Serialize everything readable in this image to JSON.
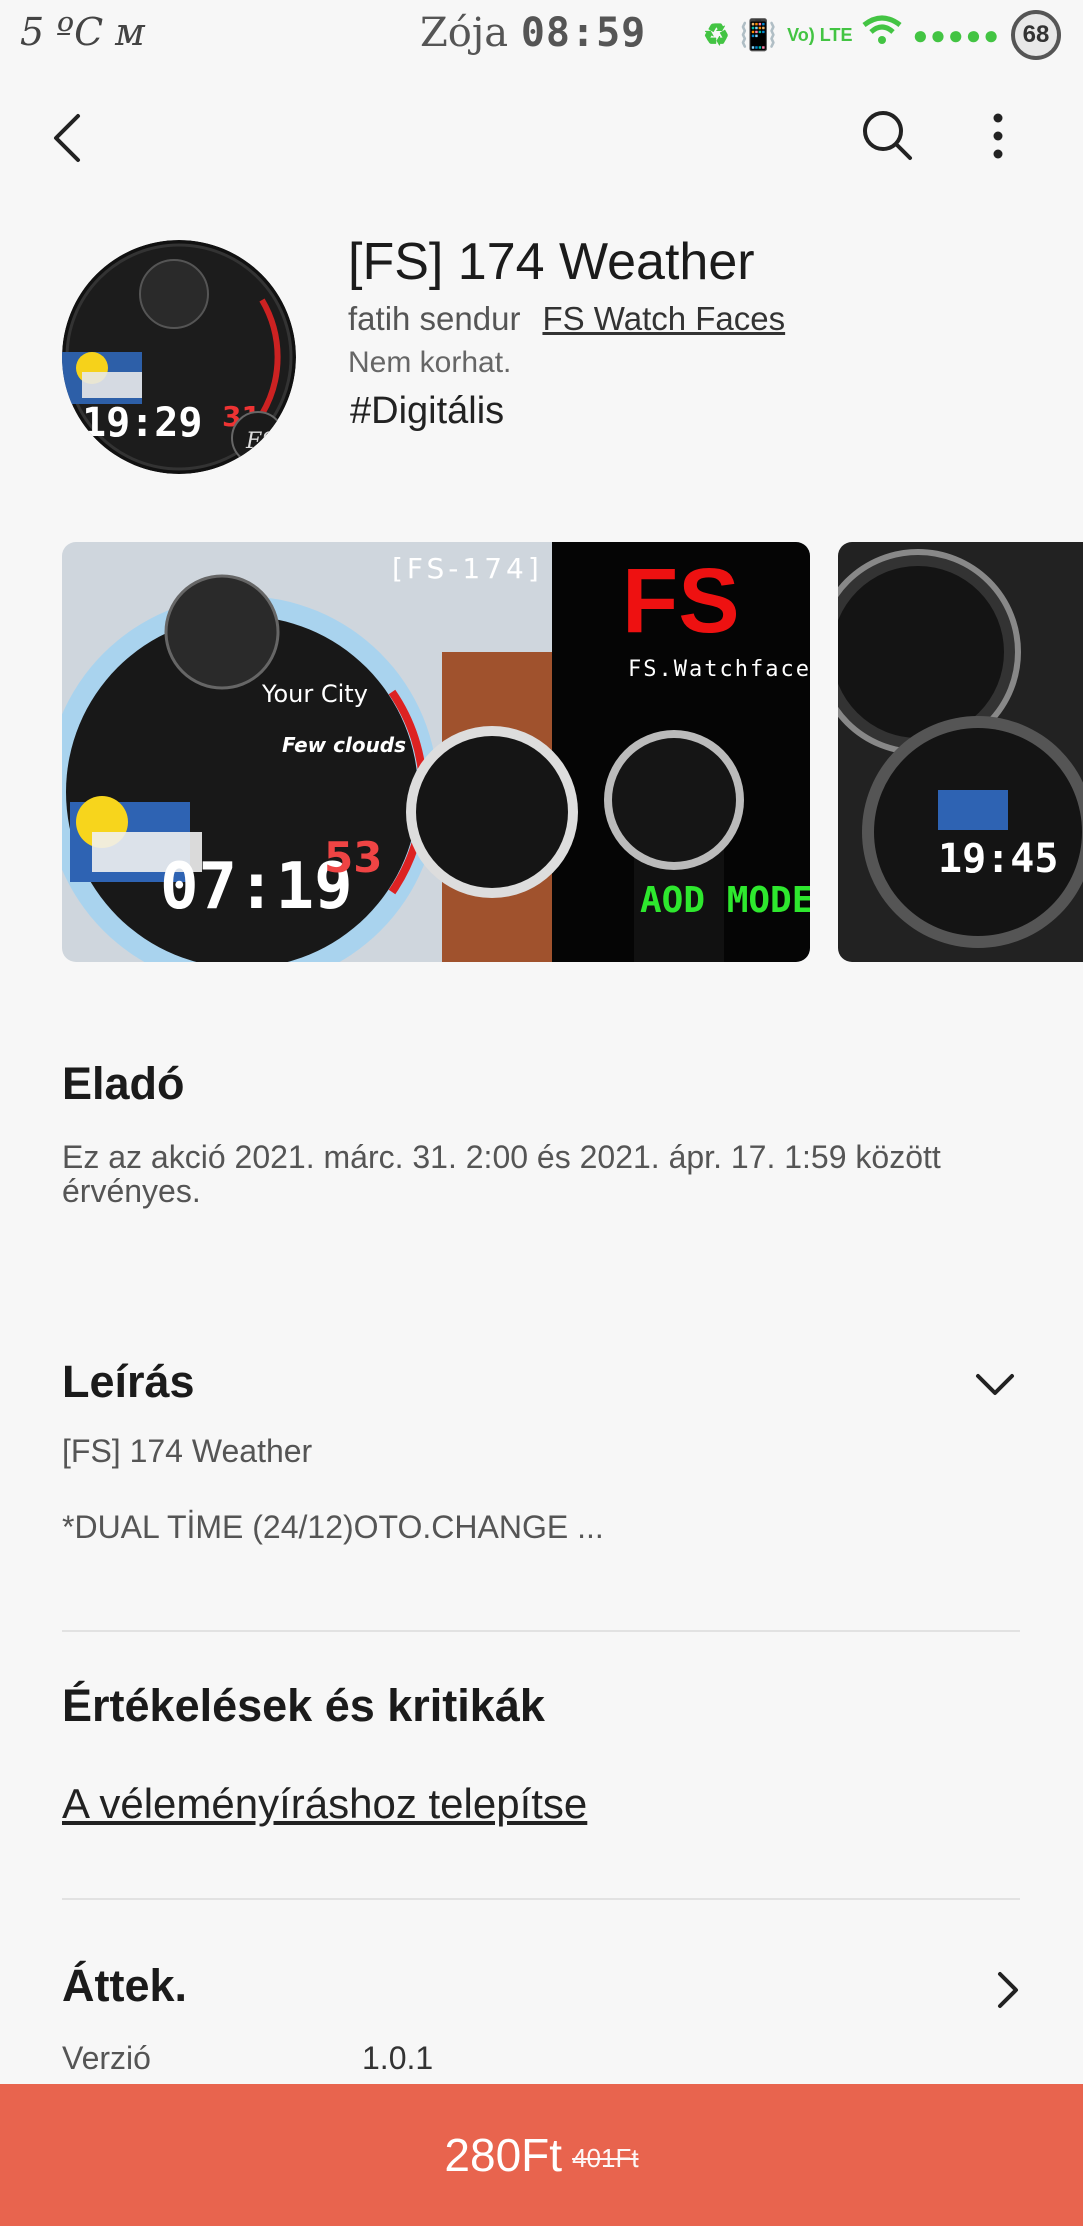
{
  "status_bar": {
    "left_text": "5 ºC ᴍ",
    "carrier": "Zója",
    "time": "08:59",
    "network": "Vo) LTE",
    "battery": "68"
  },
  "app": {
    "title": "[FS] 174 Weather",
    "developer": "fatih sendur",
    "developer_link": "FS Watch Faces",
    "age_rating": "Nem korhat.",
    "tag": "#Digitális"
  },
  "screenshots": [
    {
      "main_time": "07:19",
      "seconds": "53",
      "city": "Your City",
      "weather": "Few clouds",
      "watermark": "[FS-174]",
      "brand": "FS.Watchface",
      "badge": "AOD MODE"
    },
    {
      "main_time": "19:45"
    }
  ],
  "sale": {
    "title": "Eladó",
    "text": "Ez az akció 2021. márc. 31. 2:00 és 2021. ápr. 17. 1:59 között érvényes."
  },
  "description": {
    "title": "Leírás",
    "line1": "[FS] 174 Weather",
    "line2": "*DUAL TİME (24/12)OTO.CHANGE  ..."
  },
  "reviews": {
    "title": "Értékelések és kritikák",
    "link": "A véleményíráshoz telepítse"
  },
  "overview": {
    "title": "Áttek.",
    "version_label": "Verzió",
    "version_value": "1.0.1"
  },
  "buy": {
    "price": "280Ft",
    "old_price": "401Ft"
  },
  "colors": {
    "accent": "#e8644e",
    "status_green": "#43c443"
  }
}
